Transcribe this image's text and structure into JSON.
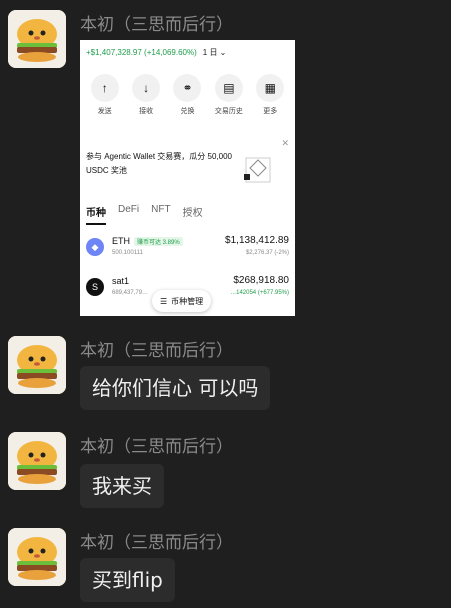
{
  "sender": "本初（三思而后行）",
  "wallet": {
    "balance_change": "+$1,407,328.97 (+14,069.60%)",
    "period": "1 日",
    "actions": [
      {
        "icon": "arrow-up-icon",
        "label": "发送"
      },
      {
        "icon": "arrow-down-icon",
        "label": "接收"
      },
      {
        "icon": "swap-icon",
        "label": "兑换"
      },
      {
        "icon": "history-icon",
        "label": "交易历史"
      },
      {
        "icon": "grid-icon",
        "label": "更多"
      }
    ],
    "promo": "参与 Agentic Wallet 交易赛，瓜分 50,000 USDC 奖池",
    "tabs": [
      "币种",
      "DeFi",
      "NFT",
      "授权"
    ],
    "tokens": [
      {
        "symbol": "ETH",
        "badge": "赚币可达 3.89%",
        "amount": "500.100111",
        "value": "$1,138,412.89",
        "change": "$2,276.37 (-2%)"
      },
      {
        "symbol": "sat1",
        "badge": "",
        "amount": "689,437,79…",
        "value": "$268,918.80",
        "change": "…142054 (+677.95%)"
      }
    ],
    "manage_label": "币种管理"
  },
  "messages": [
    {
      "text": "给你们信心 可以吗"
    },
    {
      "text": "我来买"
    },
    {
      "text": "买到flip"
    }
  ]
}
